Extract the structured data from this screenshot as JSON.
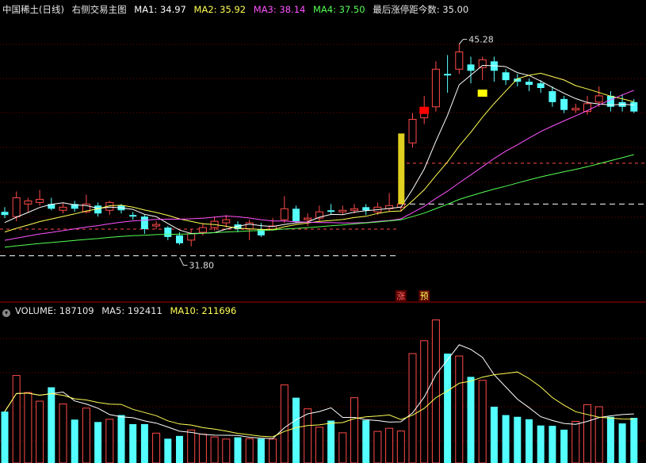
{
  "header": {
    "stock": "中国稀土(日线)",
    "indicator": "右侧交易主图",
    "ma1_label": "MA1:",
    "ma1": "34.97",
    "ma2_label": "MA2:",
    "ma2": "35.92",
    "ma3_label": "MA3:",
    "ma3": "38.14",
    "ma4_label": "MA4:",
    "ma4": "37.50",
    "limit_label": "最后涨停距今数:",
    "limit": "35.00"
  },
  "volume_header": {
    "label": "VOLUME:",
    "value": "187109",
    "ma5_label": "MA5:",
    "ma5": "192411",
    "ma10_label": "MA10:",
    "ma10": "211696"
  },
  "colors": {
    "up": "#ff4a4a",
    "down": "#54ffff",
    "ma1": "#ffffff",
    "ma2": "#ffff54",
    "ma3": "#ff54ff",
    "ma4": "#54ff54",
    "grid": "#7a0000",
    "marker_red": "#ff0000",
    "marker_yellow": "#ffff00",
    "bar_gold": "#e0d020"
  },
  "chart_data": [
    {
      "type": "candlestick",
      "title": "右侧交易主图",
      "ylim": [
        29.0,
        47.0
      ],
      "annotations": [
        {
          "text": "45.28",
          "type": "high",
          "index": 39
        },
        {
          "text": "31.80",
          "type": "low",
          "index": 15
        }
      ],
      "signals": [
        {
          "text": "涨",
          "index": 34
        },
        {
          "text": "预",
          "index": 36
        }
      ],
      "ohlc": [
        [
          34.6,
          34.4,
          34.9,
          34.2
        ],
        [
          34.3,
          35.5,
          35.9,
          34.0
        ],
        [
          35.1,
          35.3,
          35.5,
          34.6
        ],
        [
          35.2,
          35.4,
          36.0,
          35.0
        ],
        [
          35.1,
          34.8,
          35.5,
          34.7
        ],
        [
          34.7,
          34.9,
          35.2,
          34.5
        ],
        [
          35.1,
          34.8,
          35.3,
          34.6
        ],
        [
          34.6,
          35.1,
          35.7,
          34.5
        ],
        [
          35.0,
          34.5,
          35.2,
          34.3
        ],
        [
          34.7,
          35.2,
          35.3,
          34.4
        ],
        [
          35.0,
          34.7,
          35.1,
          34.5
        ],
        [
          34.4,
          34.3,
          34.6,
          34.1
        ],
        [
          34.3,
          33.5,
          34.4,
          33.2
        ],
        [
          33.7,
          33.8,
          34.0,
          33.5
        ],
        [
          33.6,
          33.0,
          33.7,
          32.8
        ],
        [
          33.1,
          32.6,
          33.3,
          32.5
        ],
        [
          32.8,
          33.2,
          33.5,
          32.4
        ],
        [
          33.3,
          33.6,
          33.9,
          33.1
        ],
        [
          33.6,
          34.0,
          34.3,
          33.4
        ],
        [
          33.9,
          34.1,
          34.4,
          33.6
        ],
        [
          33.8,
          33.5,
          34.0,
          33.3
        ],
        [
          33.5,
          33.9,
          34.1,
          32.8
        ],
        [
          33.5,
          33.1,
          33.9,
          33.0
        ],
        [
          33.5,
          33.7,
          34.2,
          33.4
        ],
        [
          34.1,
          34.8,
          35.6,
          33.9
        ],
        [
          34.8,
          34.0,
          35.0,
          33.9
        ],
        [
          34.1,
          34.2,
          34.5,
          33.7
        ],
        [
          34.2,
          34.6,
          35.0,
          34.0
        ],
        [
          34.7,
          34.6,
          35.1,
          34.4
        ],
        [
          34.6,
          34.7,
          35.0,
          34.4
        ],
        [
          34.7,
          34.8,
          35.1,
          34.5
        ],
        [
          34.9,
          34.7,
          35.1,
          34.4
        ],
        [
          34.6,
          34.9,
          35.2,
          34.4
        ],
        [
          34.8,
          35.0,
          35.8,
          34.6
        ],
        [
          34.9,
          35.1,
          35.2,
          34.6
        ],
        [
          39.0,
          40.5,
          40.9,
          38.7
        ],
        [
          40.6,
          41.2,
          42.0,
          40.2
        ],
        [
          41.3,
          43.7,
          44.2,
          41.0
        ],
        [
          43.4,
          43.3,
          44.6,
          42.2
        ],
        [
          43.7,
          44.8,
          45.3,
          43.4
        ],
        [
          44.0,
          43.6,
          44.5,
          42.8
        ],
        [
          43.8,
          44.3,
          44.5,
          43.0
        ],
        [
          44.2,
          43.6,
          44.5,
          42.9
        ],
        [
          43.5,
          43.0,
          43.7,
          42.7
        ],
        [
          43.1,
          42.9,
          43.4,
          42.6
        ],
        [
          42.9,
          42.7,
          43.1,
          42.3
        ],
        [
          42.8,
          42.5,
          43.0,
          42.2
        ],
        [
          42.3,
          41.6,
          42.6,
          41.3
        ],
        [
          41.8,
          41.1,
          42.0,
          40.9
        ],
        [
          41.1,
          41.2,
          41.5,
          40.9
        ],
        [
          41.0,
          41.5,
          42.0,
          40.8
        ],
        [
          41.6,
          42.0,
          42.6,
          41.3
        ],
        [
          42.0,
          41.3,
          42.3,
          41.0
        ],
        [
          41.6,
          41.3,
          42.1,
          41.0
        ],
        [
          41.6,
          41.0,
          41.8,
          40.9
        ]
      ],
      "ma_lines": [
        "MA1",
        "MA2",
        "MA3",
        "MA4"
      ]
    },
    {
      "type": "bar",
      "title": "VOLUME",
      "ylim": [
        0,
        420000
      ],
      "volume": [
        148000,
        252000,
        203000,
        178000,
        218000,
        170000,
        125000,
        158000,
        118000,
        126000,
        138000,
        112000,
        112000,
        86000,
        70000,
        78000,
        95000,
        83000,
        75000,
        69000,
        74000,
        70000,
        70000,
        69000,
        225000,
        188000,
        156000,
        103000,
        122000,
        87000,
        188000,
        123000,
        91000,
        100000,
        92000,
        315000,
        352000,
        412000,
        315000,
        308000,
        248000,
        238000,
        162000,
        138000,
        133000,
        126000,
        108000,
        107000,
        96000,
        120000,
        168000,
        162000,
        133000,
        114000,
        130000
      ],
      "vol_up": [
        false,
        true,
        true,
        true,
        false,
        true,
        false,
        true,
        false,
        true,
        false,
        false,
        false,
        true,
        false,
        false,
        true,
        true,
        true,
        true,
        false,
        true,
        false,
        true,
        true,
        false,
        true,
        true,
        false,
        true,
        true,
        false,
        true,
        true,
        true,
        true,
        true,
        true,
        false,
        true,
        false,
        true,
        false,
        false,
        false,
        false,
        false,
        false,
        false,
        true,
        true,
        true,
        false,
        false,
        false
      ],
      "series": [
        {
          "name": "MA5"
        },
        {
          "name": "MA10"
        }
      ]
    }
  ]
}
